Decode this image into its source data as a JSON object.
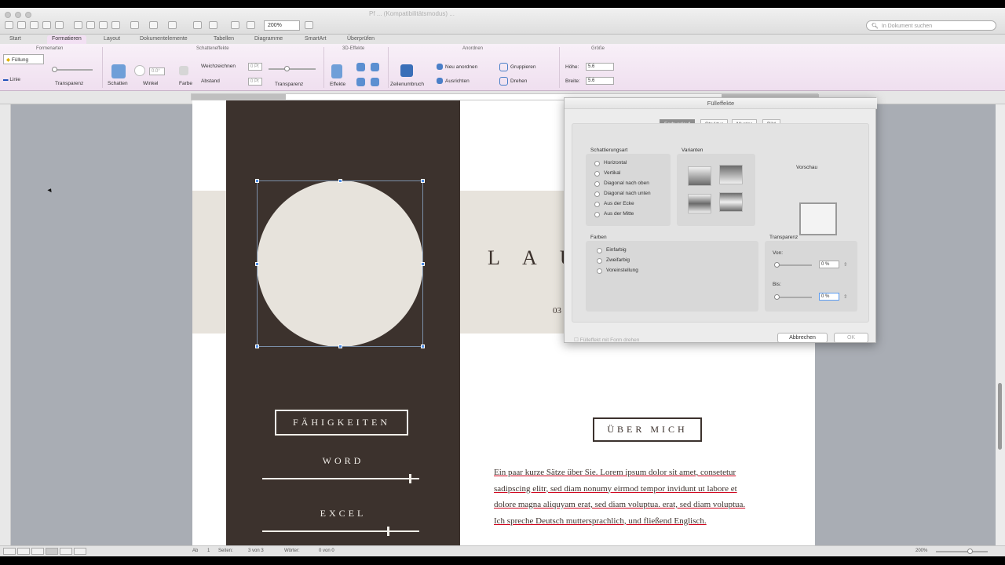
{
  "window": {
    "title": "Pf ... (Kompatibilitätsmodus) ..."
  },
  "toolbar": {
    "zoom": "200%",
    "search_placeholder": "In Dokument suchen"
  },
  "tabs": [
    "Start",
    "Formatieren",
    "Layout",
    "Dokumentelemente",
    "Tabellen",
    "Diagramme",
    "SmartArt",
    "Überprüfen"
  ],
  "active_tab": "Formatieren",
  "ribbon": {
    "groups": {
      "formenarten": "Formenarten",
      "schatteneffekte": "Schatteneffekte",
      "3d": "3D-Effekte",
      "anordnen": "Anordnen",
      "groesse": "Größe"
    },
    "fuellung": "Füllung",
    "linie": "Linie",
    "transparenz": "Transparenz",
    "schatten": "Schatten",
    "winkel": "Winkel",
    "winkel_val": "0.0°",
    "farbe": "Farbe",
    "weichzeichnen": "Weichzeichnen",
    "weichzeichnen_val": "0 Pt",
    "abstand": "Abstand",
    "abstand_val": "0 Pt",
    "transparenz2": "Transparenz",
    "effekte": "Effekte",
    "zeilenumbruch": "Zeilenumbruch",
    "neu_anordnen": "Neu anordnen",
    "ausrichten": "Ausrichten",
    "gruppieren": "Gruppieren",
    "drehen": "Drehen",
    "hoehe": "Höhe:",
    "hoehe_val": "5.6",
    "breite": "Breite:",
    "breite_val": "5.6"
  },
  "document": {
    "name": "L A U",
    "subtitle": "03",
    "skills_header": "FÄHIGKEITEN",
    "skills": [
      {
        "label": "WORD",
        "level": 0.94
      },
      {
        "label": "EXCEL",
        "level": 0.8
      }
    ],
    "about_header": "ÜBER MICH",
    "about_lines": [
      "Ein paar kurze Sätze über Sie. Lorem ipsum dolor sit amet, consetetur",
      "sadipscing elitr, sed diam nonumy eirmod tempor invidunt ut labore et",
      "dolore magna aliquyam erat, sed diam voluptua. erat, sed diam voluptua.",
      "Ich spreche Deutsch muttersprachlich, und fließend Englisch."
    ]
  },
  "dialog": {
    "title": "Fülleffekte",
    "tabs": [
      "Farbverlauf",
      "Struktur",
      "Muster",
      "Bild"
    ],
    "active_tab": "Farbverlauf",
    "shading_title": "Schattierungsart",
    "shading_options": [
      "Horizontal",
      "Vertikal",
      "Diagonal nach oben",
      "Diagonal nach unten",
      "Aus der Ecke",
      "Aus der Mitte"
    ],
    "variants_title": "Varianten",
    "preview_title": "Vorschau",
    "colors_title": "Farben",
    "color_options": [
      "Einfarbig",
      "Zweifarbig",
      "Voreinstellung"
    ],
    "transparency_title": "Transparenz",
    "from_label": "Von:",
    "from_value": "0 %",
    "to_label": "Bis:",
    "to_value": "0 %",
    "rotate_label": "Fülleffekt mit Form drehen",
    "cancel": "Abbrechen",
    "ok": "OK"
  },
  "status": {
    "ab": "Ab",
    "ab_val": "1",
    "seiten": "Seiten:",
    "seiten_val": "3 von 3",
    "woerter": "Wörter:",
    "woerter_val": "0 von 0",
    "zoom": "200%"
  }
}
